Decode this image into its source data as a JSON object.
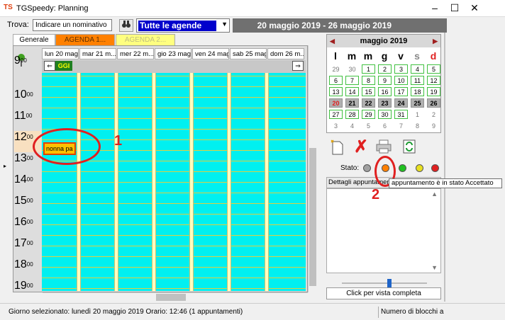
{
  "window": {
    "title": "TGSpeedy: Planning",
    "icon_text": "TS",
    "minimize": "–",
    "maximize": "☐",
    "close": "✕"
  },
  "toolbar": {
    "trova_label": "Trova:",
    "trova_value": "Indicare un nominativo",
    "agenda_select": "Tutte le agende",
    "date_range": "20 maggio 2019 - 26 maggio 2019"
  },
  "tabs": [
    {
      "label": "Generale"
    },
    {
      "label": "AGENDA 1..."
    },
    {
      "label": "AGENDA 2..."
    }
  ],
  "days": [
    {
      "label": "lun 20 mag"
    },
    {
      "label": "mar 21 m..."
    },
    {
      "label": "mer 22 m..."
    },
    {
      "label": "gio 23 mag"
    },
    {
      "label": "ven 24 mag"
    },
    {
      "label": "sab 25 mag"
    },
    {
      "label": "dom 26 m..."
    }
  ],
  "oggi_label": "GGI",
  "hours": [
    {
      "h": "9",
      "m": "00"
    },
    {
      "h": "10",
      "m": "00"
    },
    {
      "h": "11",
      "m": "00"
    },
    {
      "h": "12",
      "m": "00"
    },
    {
      "h": "13",
      "m": "00"
    },
    {
      "h": "14",
      "m": "00"
    },
    {
      "h": "15",
      "m": "00"
    },
    {
      "h": "16",
      "m": "00"
    },
    {
      "h": "17",
      "m": "00"
    },
    {
      "h": "18",
      "m": "00"
    },
    {
      "h": "19",
      "m": "00"
    }
  ],
  "appointment": {
    "label": "nonna pa",
    "fill": "#ffc000",
    "border": "#e04000"
  },
  "annotations": {
    "one": "1",
    "two": "2",
    "color": "#e02020"
  },
  "calendar": {
    "month_label": "maggio 2019",
    "prev": "◀",
    "next": "▶",
    "weekdays": [
      "l",
      "m",
      "m",
      "g",
      "v",
      "s",
      "d"
    ],
    "weeks": [
      [
        "29",
        "30",
        "1",
        "2",
        "3",
        "4",
        "5"
      ],
      [
        "6",
        "7",
        "8",
        "9",
        "10",
        "11",
        "12"
      ],
      [
        "13",
        "14",
        "15",
        "16",
        "17",
        "18",
        "19"
      ],
      [
        "20",
        "21",
        "22",
        "23",
        "24",
        "25",
        "26"
      ],
      [
        "27",
        "28",
        "29",
        "30",
        "31",
        "1",
        "2"
      ],
      [
        "3",
        "4",
        "5",
        "6",
        "7",
        "8",
        "9"
      ]
    ]
  },
  "stato_label": "Stato:",
  "stato_colors": [
    "#a0a0a0",
    "#ff8000",
    "#20c020",
    "#e8e020",
    "#e02020"
  ],
  "tooltip": "appuntamento è in stato Accettato",
  "dettagli_label": "Dettagli appuntament",
  "full_view_label": "Click per vista completa",
  "status": {
    "text": "Giorno selezionato: lunedì 20 maggio 2019  Orario: 12:46   (1 appuntamenti)",
    "right": "Numero di blocchi a"
  }
}
